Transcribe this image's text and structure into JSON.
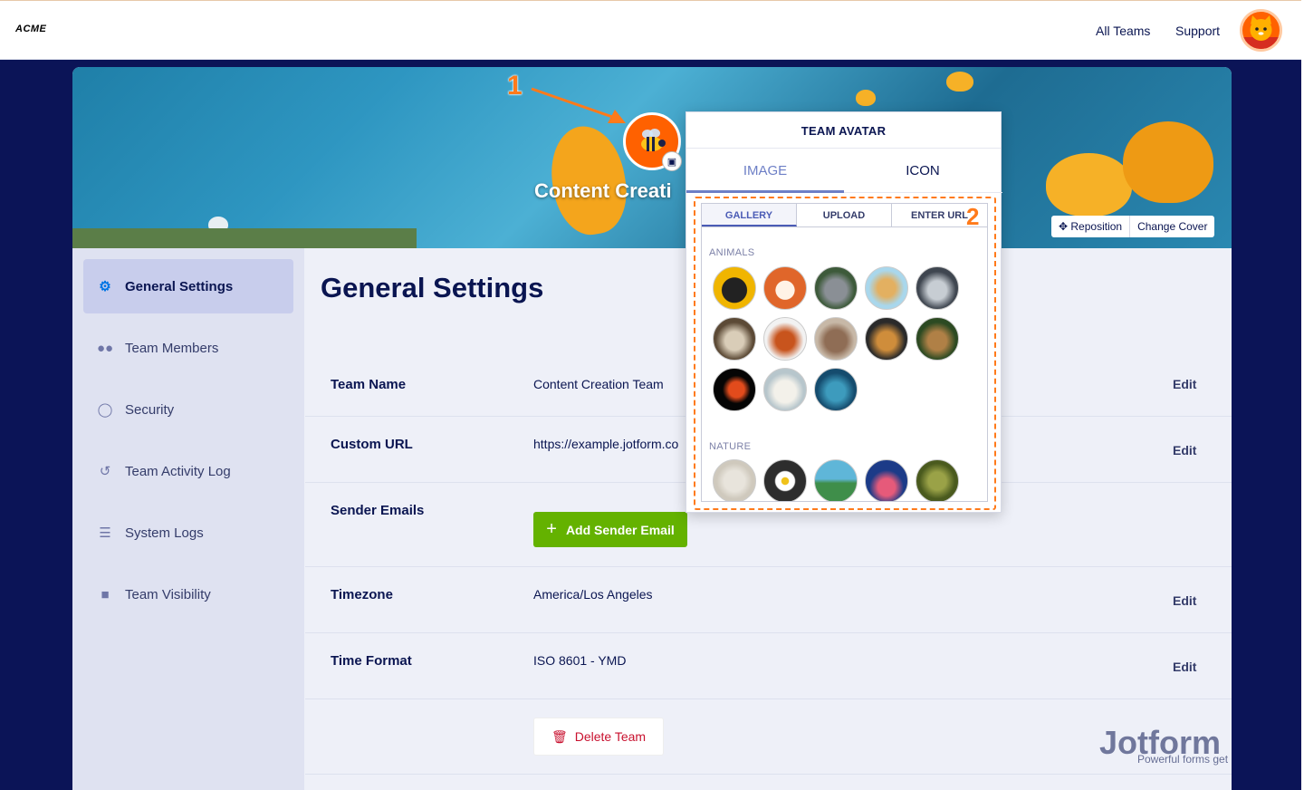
{
  "topbar": {
    "logo": "ACME",
    "links": [
      "All Teams",
      "Support"
    ],
    "avatar_icon": "cat-avatar-icon"
  },
  "cover": {
    "team_title": "Content Creati",
    "reposition_label": "Reposition",
    "change_cover_label": "Change Cover",
    "step1": "1",
    "step2": "2"
  },
  "sidebar": {
    "items": [
      {
        "label": "General Settings",
        "icon": "gear-icon",
        "active": true
      },
      {
        "label": "Team Members",
        "icon": "users-icon"
      },
      {
        "label": "Security",
        "icon": "shield-icon"
      },
      {
        "label": "Team Activity Log",
        "icon": "history-icon"
      },
      {
        "label": "System Logs",
        "icon": "database-icon"
      },
      {
        "label": "Team Visibility",
        "icon": "lock-icon"
      }
    ]
  },
  "main": {
    "title": "General Settings",
    "rows": [
      {
        "label": "Team Name",
        "value": "Content Creation Team",
        "edit": "Edit"
      },
      {
        "label": "Custom URL",
        "value": "https://example.jotform.co",
        "edit": "Edit"
      },
      {
        "label": "Sender Emails",
        "button": "Add Sender Email"
      },
      {
        "label": "Timezone",
        "value": "America/Los Angeles",
        "edit": "Edit"
      },
      {
        "label": "Time Format",
        "value": "ISO 8601 - YMD",
        "edit": "Edit"
      }
    ],
    "delete_label": "Delete Team"
  },
  "popup": {
    "title": "TEAM AVATAR",
    "tabs": [
      "IMAGE",
      "ICON"
    ],
    "subtabs": [
      "GALLERY",
      "UPLOAD",
      "ENTER URL"
    ],
    "categories": [
      "ANIMALS",
      "NATURE"
    ]
  },
  "watermark": {
    "brand": "Jotform",
    "tagline": "Powerful forms get"
  },
  "colors": {
    "page_bg": "#0b1457",
    "accent_green": "#64b200",
    "accent_orange": "#ff6100",
    "active_tab": "#6d7fc6"
  }
}
